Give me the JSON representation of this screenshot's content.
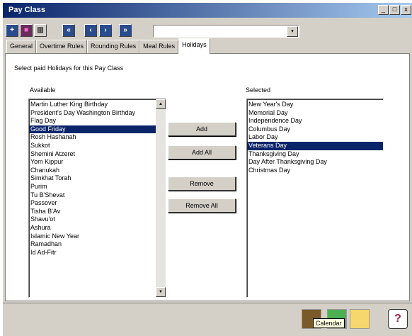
{
  "window": {
    "title": "Pay Class",
    "controls": [
      "_",
      "□",
      "x"
    ]
  },
  "toolbar": {
    "combo_value": "",
    "combo_arrow": "▾"
  },
  "tabs": [
    {
      "label": "General"
    },
    {
      "label": "Overtime Rules"
    },
    {
      "label": "Rounding Rules"
    },
    {
      "label": "Meal Rules"
    },
    {
      "label": "Holidays",
      "active": true
    }
  ],
  "prompt": "Select paid Holidays for this Pay Class",
  "available": {
    "label": "Available",
    "items": [
      "Martin Luther King Birthday",
      "President's Day Washington Birthday",
      "Flag Day",
      "Good Friday",
      "Rosh Hashanah",
      "Sukkot",
      "Shemini Atzeret",
      "Yom Kippur",
      "Chanukah",
      "Simkhat Torah",
      "Purim",
      "Tu B'Shevat",
      "Passover",
      "Tisha B'Av",
      "Shavu'ot",
      "Ashura",
      "Islamic New Year",
      "Ramadhan",
      "Id Ad-Fitr"
    ],
    "selected_index": 3
  },
  "selected": {
    "label": "Selected",
    "items": [
      "New Year's Day",
      "Memorial Day",
      "Independence Day",
      "Columbus Day",
      "Labor Day",
      "Veterans Day",
      "Thanksgiving Day",
      "Day After Thanksgiving Day",
      "Christmas Day"
    ],
    "selected_index": 5
  },
  "buttons": {
    "add": "Add",
    "add_all": "Add All",
    "remove": "Remove",
    "remove_all": "Remove All"
  },
  "tooltip": "Calendar",
  "icons": {
    "toolbar": [
      "add-record-icon",
      "save-icon",
      "delete-icon",
      "first-record-icon",
      "previous-record-icon",
      "next-record-icon",
      "last-record-icon"
    ],
    "bottom": [
      "calendar-icon",
      "ok-icon",
      "cancel-icon",
      "help-icon"
    ]
  }
}
